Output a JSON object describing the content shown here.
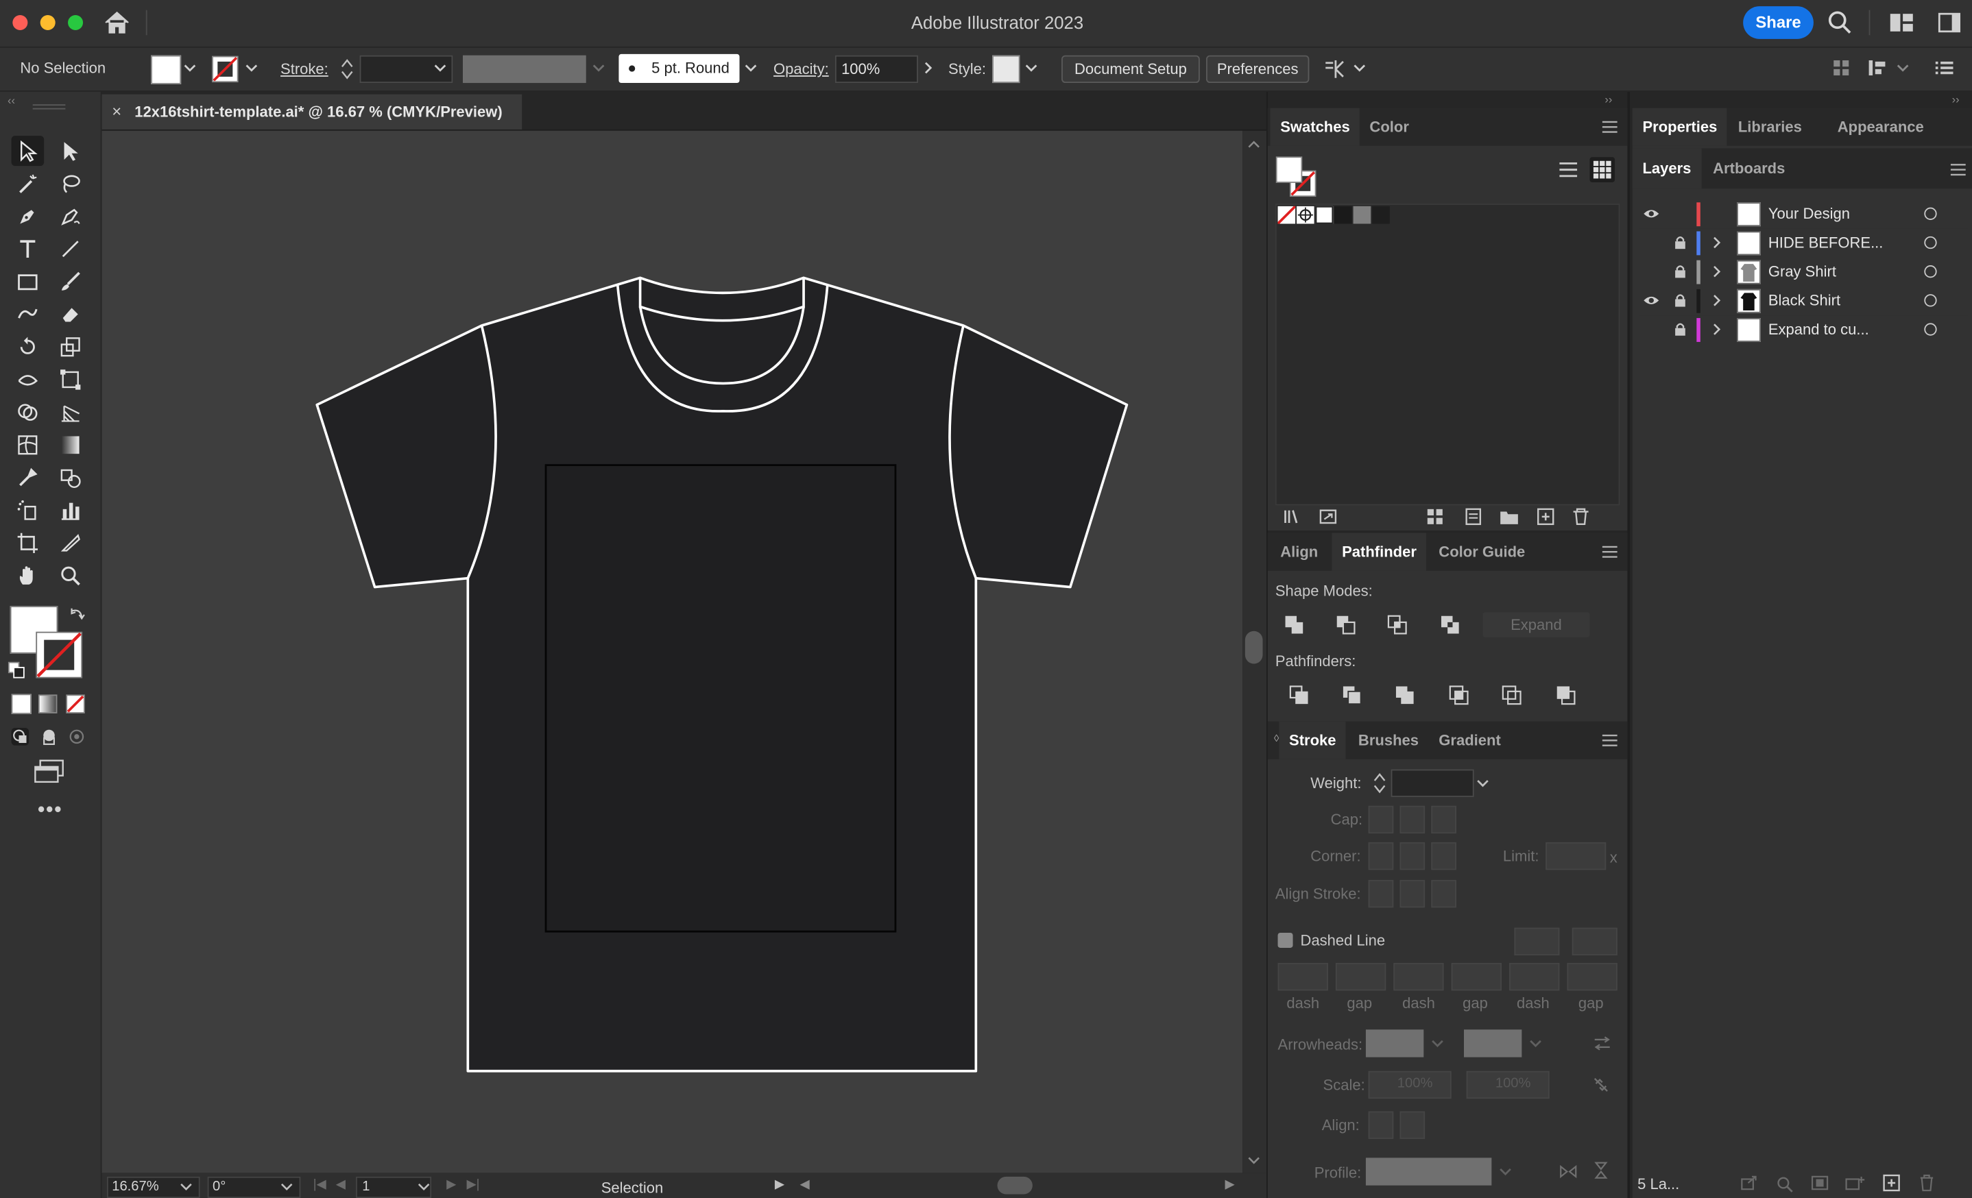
{
  "app": {
    "title": "Adobe Illustrator 2023",
    "share_label": "Share"
  },
  "control_bar": {
    "selection_label": "No Selection",
    "stroke_label": "Stroke:",
    "brush_label": "5 pt. Round",
    "opacity_label": "Opacity:",
    "opacity_value": "100%",
    "style_label": "Style:",
    "document_setup_label": "Document Setup",
    "preferences_label": "Preferences"
  },
  "document": {
    "tab_title": "12x16tshirt-template.ai* @ 16.67 % (CMYK/Preview)",
    "close_glyph": "×"
  },
  "status_bar": {
    "zoom": "16.67%",
    "rotation": "0°",
    "artboard": "1",
    "tool_mode": "Selection"
  },
  "swatches_panel": {
    "tabs": [
      "Swatches",
      "Color"
    ],
    "active_tab": "Swatches"
  },
  "pathfinder_panel": {
    "tabs": [
      "Align",
      "Pathfinder",
      "Color Guide"
    ],
    "active_tab": "Pathfinder",
    "shape_modes_label": "Shape Modes:",
    "expand_label": "Expand",
    "pathfinders_label": "Pathfinders:"
  },
  "stroke_panel": {
    "tabs": [
      "Stroke",
      "Brushes",
      "Gradient"
    ],
    "active_tab": "Stroke",
    "weight_label": "Weight:",
    "cap_label": "Cap:",
    "corner_label": "Corner:",
    "limit_label": "Limit:",
    "limit_suffix": "x",
    "align_stroke_label": "Align Stroke:",
    "dashed_line_label": "Dashed Line",
    "dash_labels": [
      "dash",
      "gap",
      "dash",
      "gap",
      "dash",
      "gap"
    ],
    "arrowheads_label": "Arrowheads:",
    "scale_label": "Scale:",
    "scale_value_1": "100%",
    "scale_value_2": "100%",
    "align_label": "Align:",
    "profile_label": "Profile:"
  },
  "right_panel": {
    "tabs": [
      "Properties",
      "Libraries",
      "Appearance"
    ],
    "active_tab": "Properties",
    "sub_tabs": [
      "Layers",
      "Artboards"
    ],
    "active_sub_tab": "Layers",
    "layers": [
      {
        "name": "Your Design",
        "visible": true,
        "locked": false,
        "color": "#e5484d",
        "expandable": false
      },
      {
        "name": "HIDE BEFORE...",
        "visible": false,
        "locked": true,
        "color": "#4f7ef0",
        "expandable": true
      },
      {
        "name": "Gray Shirt",
        "visible": false,
        "locked": true,
        "color": "#9a9a9a",
        "expandable": true
      },
      {
        "name": "Black Shirt",
        "visible": true,
        "locked": true,
        "color": "#1a1a1a",
        "expandable": true
      },
      {
        "name": "Expand to cu...",
        "visible": false,
        "locked": true,
        "color": "#d13ad8",
        "expandable": true
      }
    ],
    "footer_count": "5 La..."
  },
  "colors": {
    "accent": "#1473e6",
    "canvas_bg": "#3e3e3e",
    "shirt_fill": "#222224",
    "shirt_stroke": "#ffffff"
  }
}
